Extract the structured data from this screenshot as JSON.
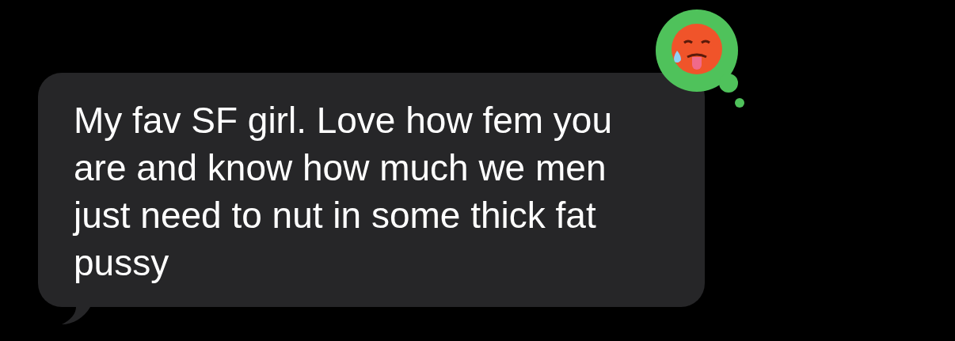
{
  "messages": [
    {
      "text": "My fav SF girl. Love how fem you are and know how much we men just need to nut in some thick fat pussy",
      "reaction": {
        "kind": "emoji"
      }
    }
  ]
}
